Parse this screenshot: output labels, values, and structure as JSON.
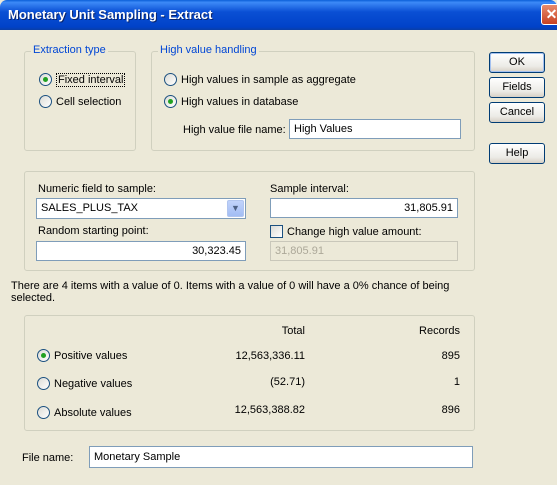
{
  "window": {
    "title": "Monetary Unit Sampling - Extract"
  },
  "extraction_type": {
    "legend": "Extraction type",
    "options": [
      {
        "label": "Fixed interval",
        "selected": true
      },
      {
        "label": "Cell selection",
        "selected": false
      }
    ]
  },
  "high_value_handling": {
    "legend": "High value handling",
    "options": [
      {
        "label": "High values in sample as aggregate",
        "selected": false
      },
      {
        "label": "High values in database",
        "selected": true
      }
    ],
    "file_label": "High value file name:",
    "file_value": "High Values"
  },
  "buttons": {
    "ok": "OK",
    "fields": "Fields",
    "cancel": "Cancel",
    "help": "Help"
  },
  "sampling": {
    "numeric_field_label": "Numeric field to sample:",
    "numeric_field_value": "SALES_PLUS_TAX",
    "sample_interval_label": "Sample interval:",
    "sample_interval_value": "31,805.91",
    "random_start_label": "Random starting point:",
    "random_start_value": "30,323.45",
    "change_high_label": "Change high value amount:",
    "change_high_checked": false,
    "change_high_value": "31,805.91"
  },
  "info_text": "There are 4 items with a value of 0.  Items with a value of 0 will have a 0% chance of being selected.",
  "values_table": {
    "total_header": "Total",
    "records_header": "Records",
    "rows": [
      {
        "label": "Positive values",
        "total": "12,563,336.11",
        "records": "895",
        "selected": true
      },
      {
        "label": "Negative values",
        "total": "(52.71)",
        "records": "1",
        "selected": false
      },
      {
        "label": "Absolute values",
        "total": "12,563,388.82",
        "records": "896",
        "selected": false
      }
    ]
  },
  "output": {
    "file_label": "File name:",
    "file_value": "Monetary Sample"
  },
  "colors": {
    "title_bar": "#0a4fd4",
    "group_legend": "#0046d5",
    "dialog_bg": "#ece9d8"
  },
  "icons": {
    "close": "close-icon",
    "dropdown": "chevron-down-icon"
  }
}
